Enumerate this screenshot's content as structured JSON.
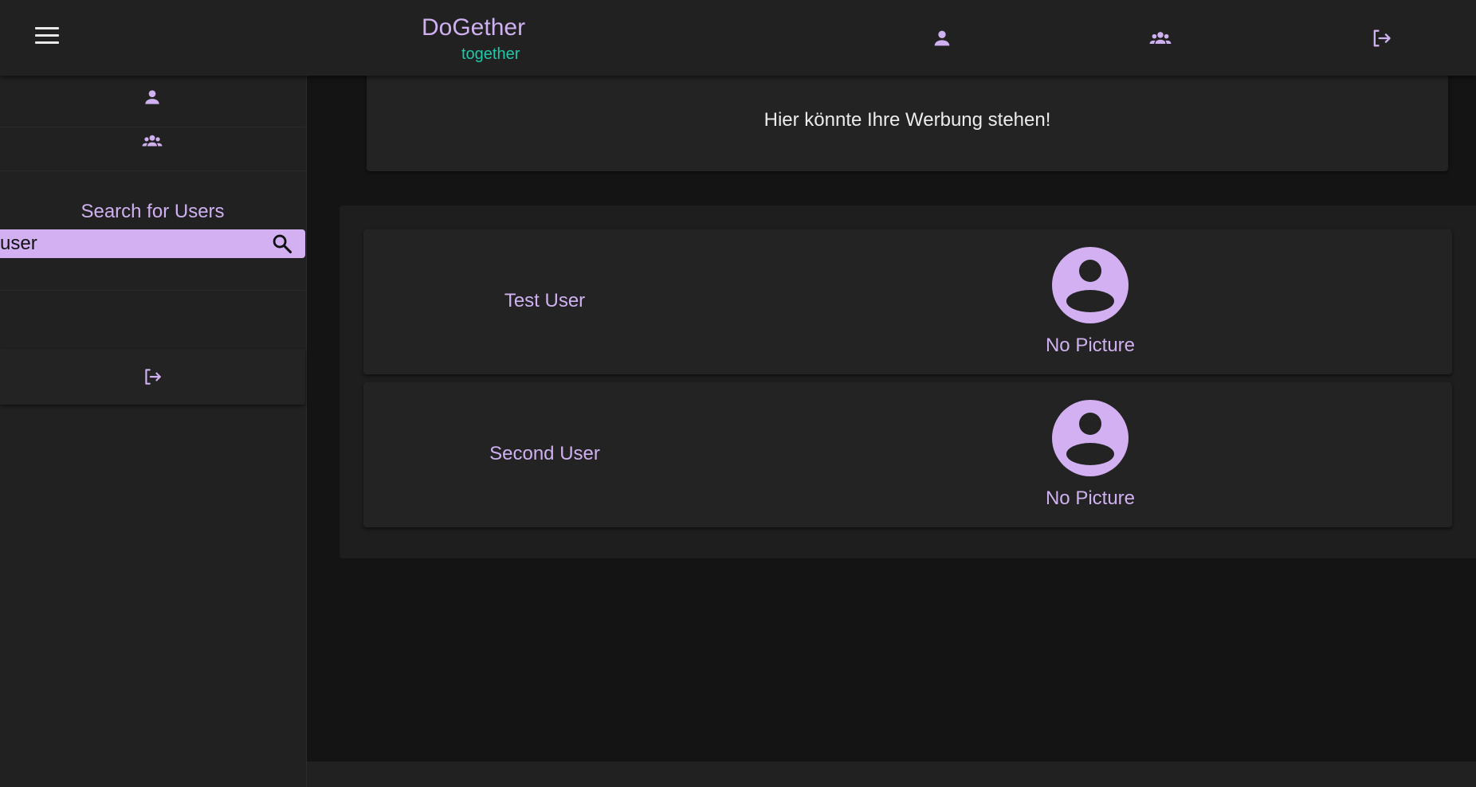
{
  "header": {
    "brand_title": "DoGether",
    "brand_subtitle": "together",
    "icons": [
      "menu-icon",
      "person-icon",
      "group-icon",
      "logout-icon"
    ]
  },
  "sidebar": {
    "search_label": "Search for Users",
    "search_value": "user",
    "icons": [
      "person-icon",
      "group-icon",
      "search-icon",
      "logout-icon"
    ]
  },
  "main": {
    "ad_text": "Hier könnte Ihre Werbung stehen!",
    "results": [
      {
        "name": "Test User",
        "picture_label": "No Picture"
      },
      {
        "name": "Second User",
        "picture_label": "No Picture"
      }
    ]
  },
  "colors": {
    "accent": "#d2b0f2",
    "accent_text": "#cfb0f0",
    "teal": "#1ec8a8",
    "background": "#141414",
    "surface": "#232323"
  }
}
